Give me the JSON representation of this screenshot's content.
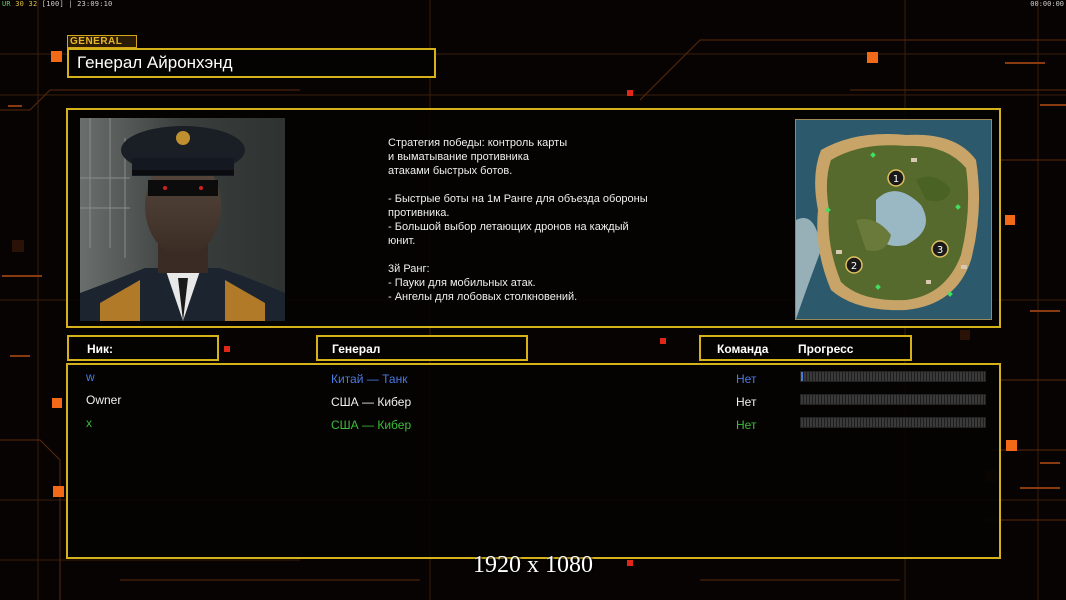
{
  "status_bar": {
    "left_prefix": "UR",
    "left_a": "30",
    "left_b": "32",
    "left_c": "[100]",
    "left_time": "23:09:10",
    "right_time": "00:00:00"
  },
  "header": {
    "tag": "GENERAL",
    "title": "Генерал Айронхэнд"
  },
  "description": "Стратегия победы: контроль карты\nи выматывание противника\nатаками быстрых ботов.\n\n- Быстрые боты на 1м Ранге для объезда обороны\n противника.\n- Большой выбор летающих дронов на каждый\n юнит.\n\n3й Ранг:\n- Пауки для мобильных атак.\n- Ангелы для лобовых столкновений.",
  "map": {
    "markers": [
      "1",
      "2",
      "3"
    ]
  },
  "columns": {
    "nick": "Ник:",
    "general": "Генерал",
    "team": "Команда",
    "progress": "Прогресс"
  },
  "players": [
    {
      "nick": "w",
      "general": "Китай — Танк",
      "team": "Нет",
      "color": "#4a7ae0",
      "progress": 0.01
    },
    {
      "nick": "Owner",
      "general": "США — Кибер",
      "team": "Нет",
      "color": "#f0f0f0",
      "progress": 0
    },
    {
      "nick": "x",
      "general": "США — Кибер",
      "team": "Нет",
      "color": "#3bbd3b",
      "progress": 0
    }
  ],
  "resolution": "1920 x 1080",
  "colors": {
    "frame": "#d6b21a",
    "accent": "#e8601a",
    "background": "#060302"
  }
}
